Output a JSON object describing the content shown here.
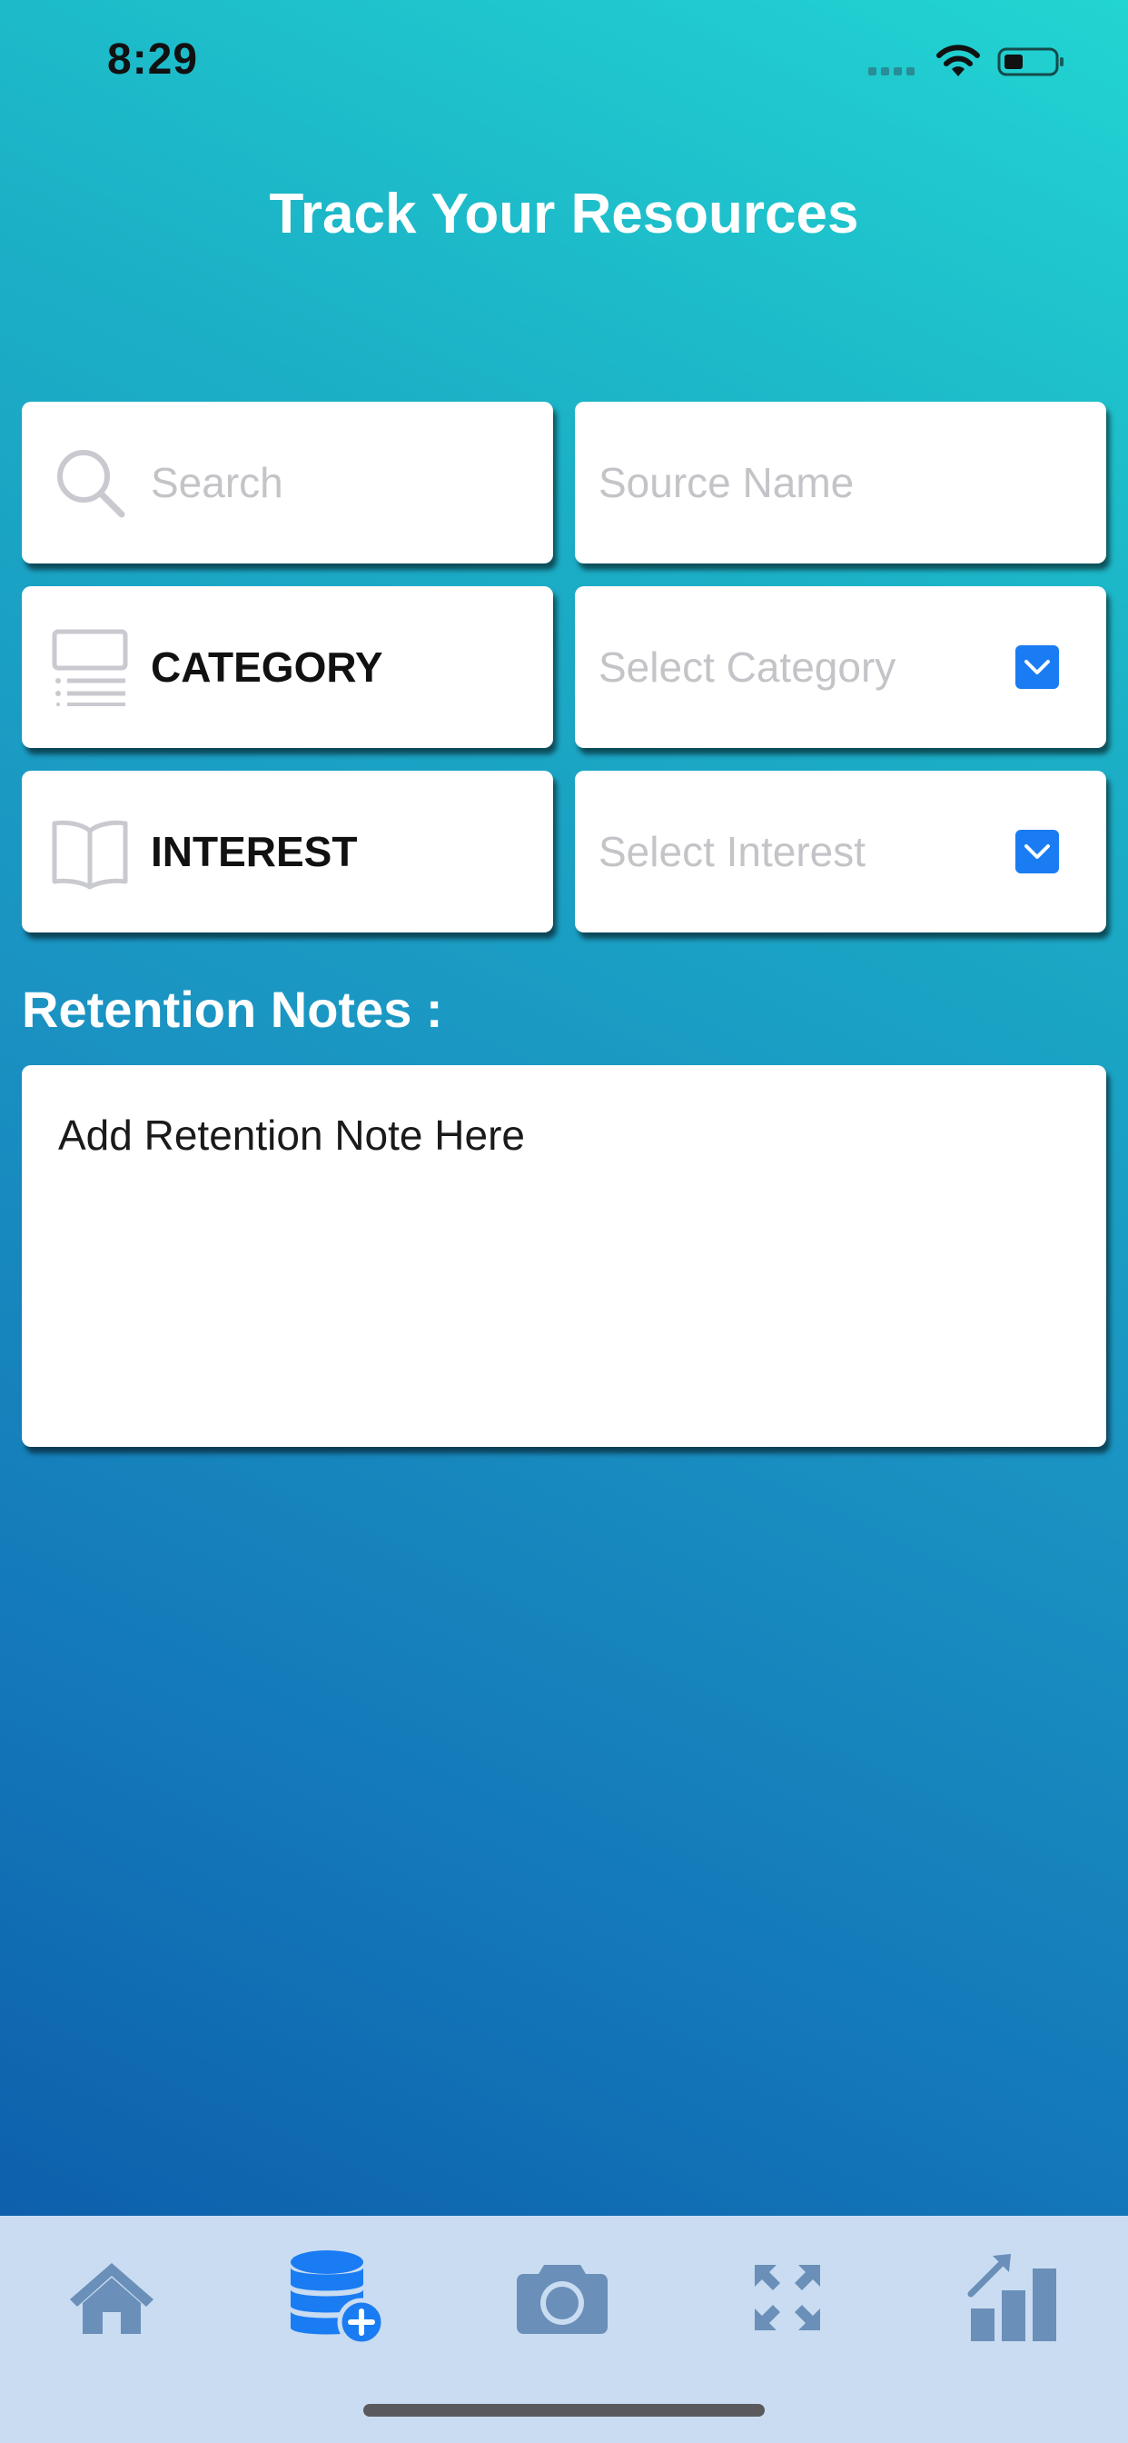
{
  "status_bar": {
    "time": "8:29"
  },
  "header": {
    "title": "Track Your Resources"
  },
  "form": {
    "search": {
      "icon": "search-icon",
      "placeholder": "Search"
    },
    "source_name": {
      "placeholder": "Source Name"
    },
    "category": {
      "icon": "list-icon",
      "label": "CATEGORY",
      "select_placeholder": "Select Category"
    },
    "interest": {
      "icon": "book-icon",
      "label": "INTEREST",
      "select_placeholder": "Select Interest"
    },
    "notes": {
      "label": "Retention Notes :",
      "placeholder": "Add Retention Note Here"
    }
  },
  "tab_bar": {
    "items": [
      {
        "icon": "home-icon",
        "active": false
      },
      {
        "icon": "database-add-icon",
        "active": true
      },
      {
        "icon": "camera-icon",
        "active": false
      },
      {
        "icon": "expand-icon",
        "active": false
      },
      {
        "icon": "bar-chart-icon",
        "active": false
      }
    ]
  },
  "colors": {
    "accent": "#1a7cf2",
    "tab_inactive": "#6a8fb8",
    "tab_active": "#1a7cf2",
    "placeholder": "#c4c4c8"
  }
}
